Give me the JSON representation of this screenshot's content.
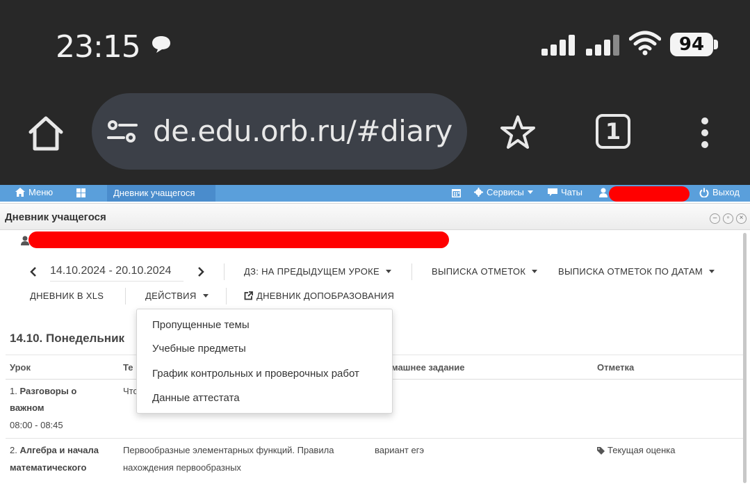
{
  "status_bar": {
    "time": "23:15",
    "battery": "94"
  },
  "browser": {
    "url": "de.edu.orb.ru/#diary",
    "tab_count": "1"
  },
  "top_nav": {
    "menu_label": "Меню",
    "active_tab_label": "Дневник учащегося",
    "services_label": "Сервисы",
    "chats_label": "Чаты",
    "logout_label": "Выход"
  },
  "window": {
    "title": "Дневник учащегося"
  },
  "toolbar": {
    "date_range": "14.10.2024 - 20.10.2024",
    "homework_mode": "ДЗ: НА ПРЕДЫДУЩЕМ УРОКЕ",
    "marks_extract": "ВЫПИСКА ОТМЕТОК",
    "marks_by_dates": "ВЫПИСКА ОТМЕТОК ПО ДАТАМ",
    "diary_xls": "ДНЕВНИК В XLS",
    "actions": "ДЕЙСТВИЯ",
    "extra_edu_diary": "ДНЕВНИК ДОПОБРАЗОВАНИЯ"
  },
  "actions_menu": {
    "items": [
      "Пропущенные темы",
      "Учебные предметы",
      "График контрольных и проверочных работ",
      "Данные аттестата"
    ]
  },
  "day": {
    "title": "14.10. Понедельник",
    "columns": [
      "Урок",
      "Те",
      "машнее задание",
      "Отметка"
    ],
    "lessons": [
      {
        "number": "1.",
        "name_line1": "Разговоры о",
        "name_line2": "важном",
        "time": "08:00 - 08:45",
        "topic": "Что"
      },
      {
        "number": "2.",
        "name_line1": "Алгебра и начала",
        "name_line2": "математического",
        "topic_line1": "Первообразные элементарных функций. Правила",
        "topic_line2": "нахождения первообразных",
        "homework": "вариант егэ",
        "mark": "Текущая оценка"
      }
    ]
  }
}
